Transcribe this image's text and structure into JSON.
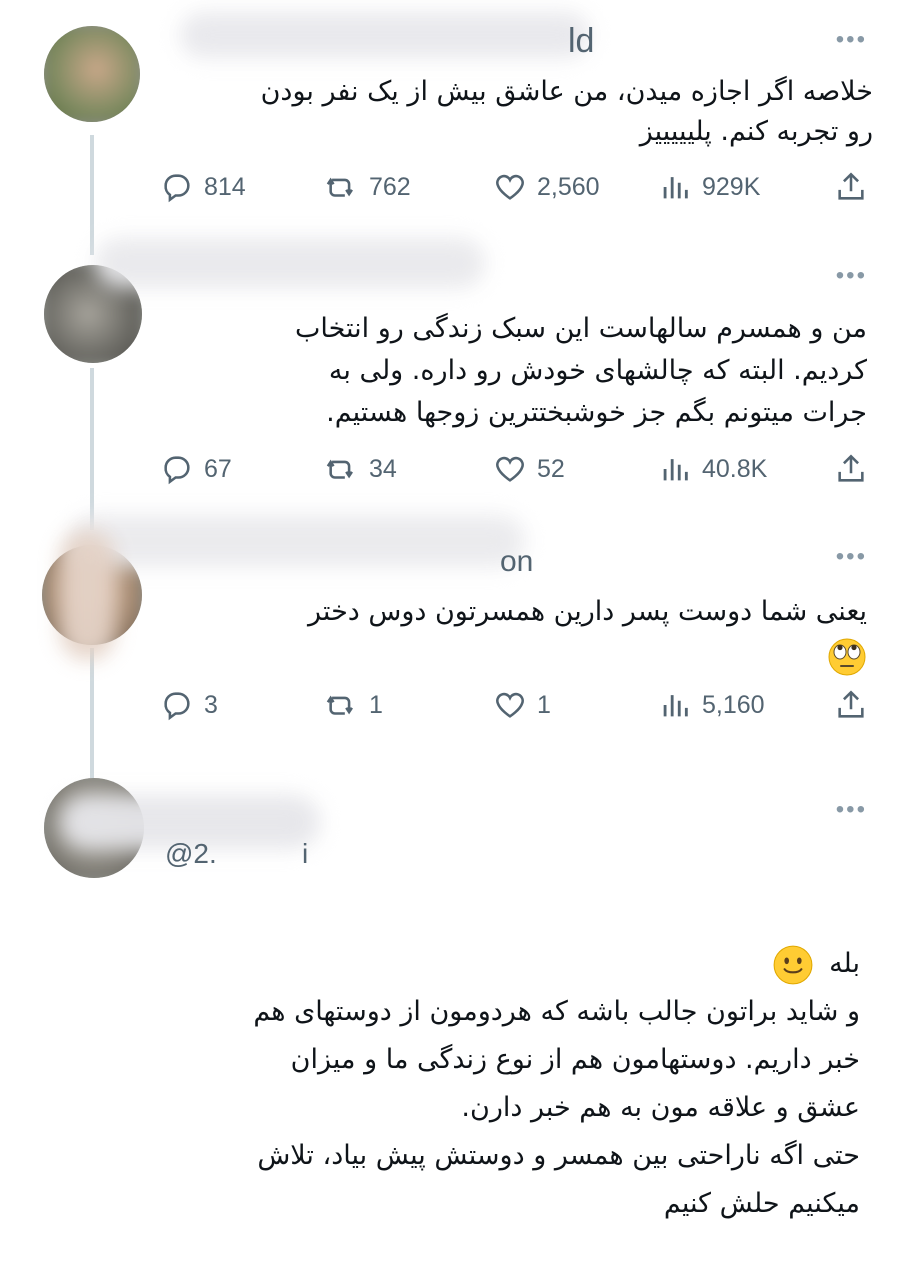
{
  "colors": {
    "text": "#0f1419",
    "meta": "#536471",
    "line": "#cfd9de"
  },
  "tweets": [
    {
      "handle_fragment": "ld",
      "text_lines": [
        "خلاصه اگر اجازه میدن، من عاشق بیش از یک نفر بودن",
        "رو تجربه کنم. پلیییییز"
      ],
      "replies": "814",
      "retweets": "762",
      "likes": "2,560",
      "views": "929K"
    },
    {
      "handle_fragment": "",
      "text_lines": [
        "من و همسرم سالهاست این سبک زندگی رو انتخاب",
        "کردیم. البته که چالشهای خودش رو داره. ولی به",
        "جرات میتونم بگم جز خوشبختترین زوجها هستیم."
      ],
      "replies": "67",
      "retweets": "34",
      "likes": "52",
      "views": "40.8K"
    },
    {
      "handle_fragment": "on",
      "text_lines": [
        "یعنی شما دوست پسر دارین همسرتون دوس دختر"
      ],
      "emoji": "eye-roll-face",
      "replies": "3",
      "retweets": "1",
      "likes": "1",
      "views": "5,160"
    },
    {
      "handle_fragment": "@2.",
      "handle_fragment_end": "i",
      "text_lines": [
        "بله",
        "و شاید براتون جالب باشه که هردومون از دوستهای هم",
        "خبر داریم. دوستهامون هم از نوع زندگی ما و میزان",
        "عشق و علاقه مون به هم خبر دارن.",
        "حتی اگه ناراحتی بین همسر و دوستش پیش بیاد، تلاش",
        "میکنیم حلش کنیم"
      ],
      "emoji": "slightly-smiling-face"
    }
  ]
}
